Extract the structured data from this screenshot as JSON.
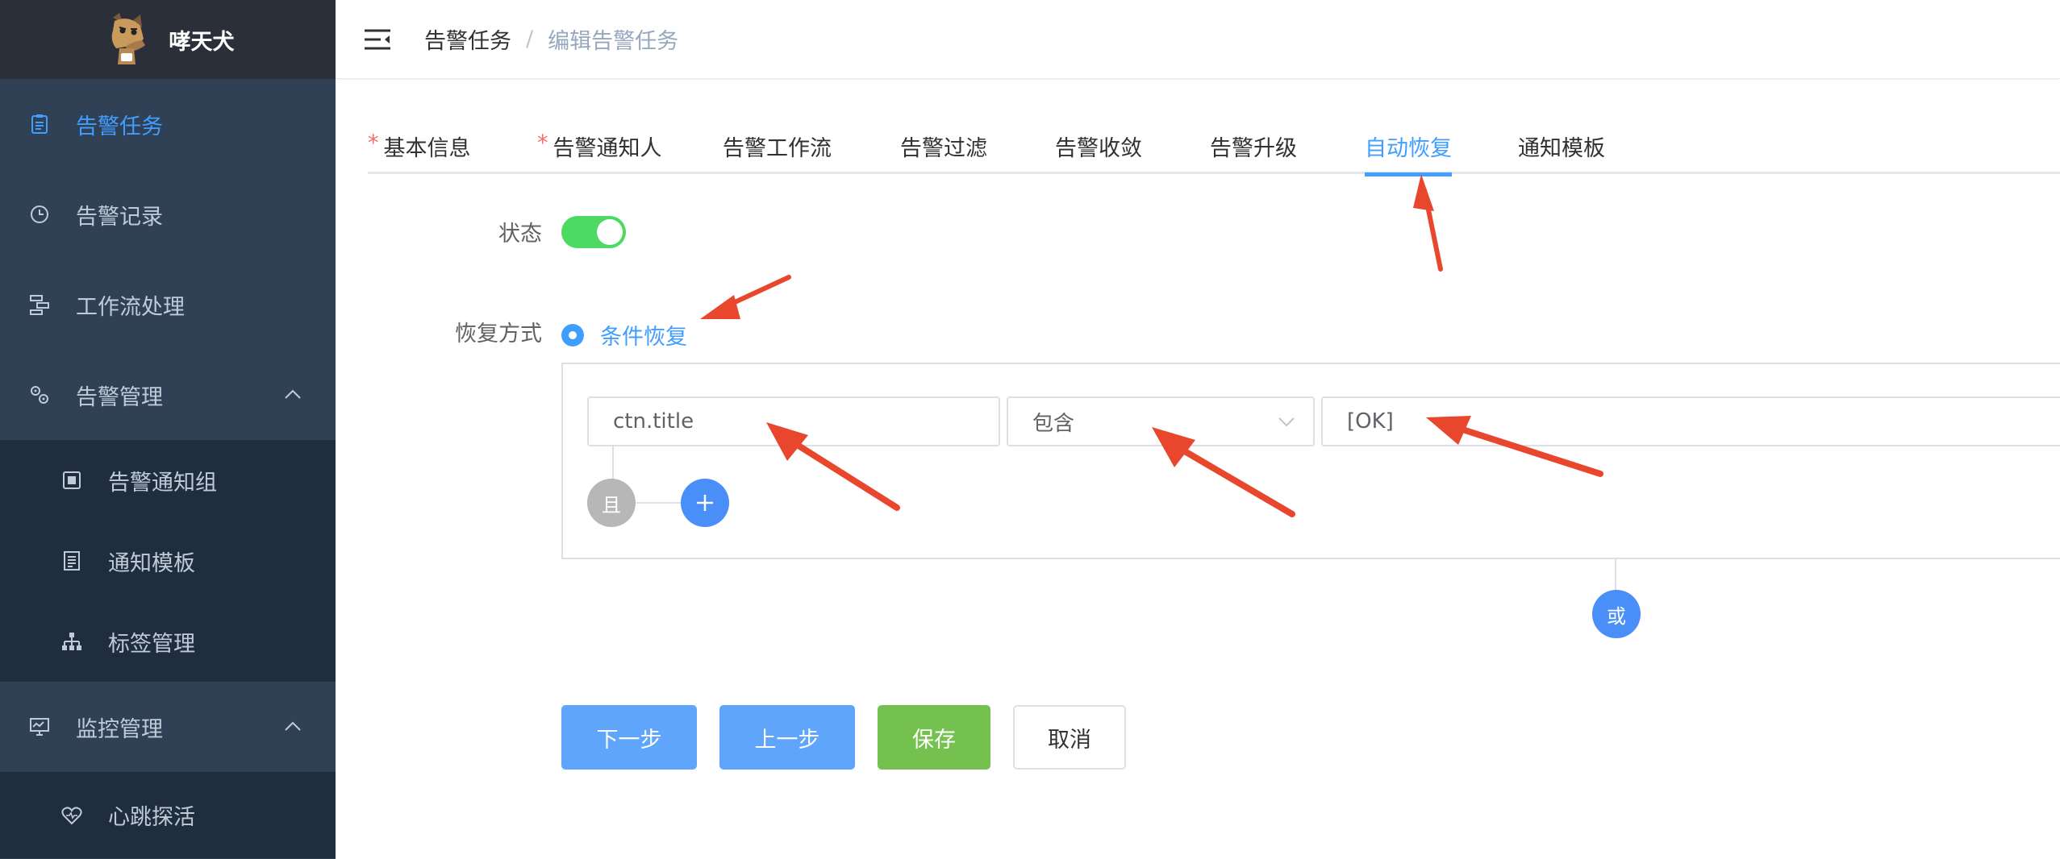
{
  "brand": {
    "name": "哮天犬",
    "logo_icon": "dog-logo-icon"
  },
  "sidebar": {
    "items": [
      {
        "label": "告警任务",
        "icon": "clipboard-icon",
        "active": true
      },
      {
        "label": "告警记录",
        "icon": "clock-icon"
      },
      {
        "label": "工作流处理",
        "icon": "flow-icon"
      },
      {
        "label": "告警管理",
        "icon": "gears-icon",
        "expanded": true
      },
      {
        "label": "告警通知组",
        "icon": "group-icon",
        "sub": true
      },
      {
        "label": "通知模板",
        "icon": "template-icon",
        "sub": true
      },
      {
        "label": "标签管理",
        "icon": "tree-icon",
        "sub": true
      },
      {
        "label": "监控管理",
        "icon": "monitor-icon",
        "expanded": true
      },
      {
        "label": "心跳探活",
        "icon": "heartbeat-icon",
        "sub": true
      }
    ]
  },
  "breadcrumb": {
    "root": "告警任务",
    "separator": "/",
    "current": "编辑告警任务"
  },
  "tabs": [
    {
      "label": "基本信息",
      "required": "*"
    },
    {
      "label": "告警通知人",
      "required": "*"
    },
    {
      "label": "告警工作流"
    },
    {
      "label": "告警过滤"
    },
    {
      "label": "告警收敛"
    },
    {
      "label": "告警升级"
    },
    {
      "label": "自动恢复",
      "active": true
    },
    {
      "label": "通知模板"
    }
  ],
  "form": {
    "status_label": "状态",
    "status_on": true,
    "recovery_label": "恢复方式",
    "recovery_option": "条件恢复",
    "condition": {
      "field_value": "ctn.title",
      "operator_value": "包含",
      "match_value": "[OK]"
    },
    "and_label": "且",
    "or_label": "或"
  },
  "buttons": {
    "next": "下一步",
    "prev": "上一步",
    "save": "保存",
    "cancel": "取消"
  },
  "colors": {
    "sidebar_bg": "#304156",
    "brand_bg": "#2b2f3a",
    "accent": "#409eff",
    "switch_on": "#4cd964",
    "save": "#75c14f",
    "annotation_arrow": "#e8462d"
  }
}
